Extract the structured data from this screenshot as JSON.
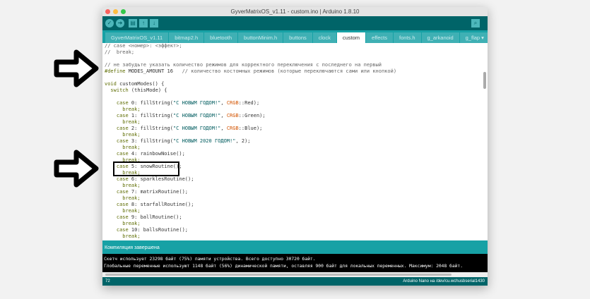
{
  "window": {
    "title": "GyverMatrixOS_v1.11 - custom.ino | Arduino 1.8.10"
  },
  "toolbar": {
    "verify": "✓",
    "upload": "➜",
    "new": "▤",
    "open": "↑",
    "save": "↓",
    "serial": "⌕"
  },
  "tabs": [
    {
      "label": "GyverMatrixOS_v1.11"
    },
    {
      "label": "bitmap2.h"
    },
    {
      "label": "bluetooth"
    },
    {
      "label": "buttonMinim.h"
    },
    {
      "label": "buttons"
    },
    {
      "label": "clock"
    },
    {
      "label": "custom",
      "active": true
    },
    {
      "label": "effects"
    },
    {
      "label": "fonts.h"
    },
    {
      "label": "g_arkanoid"
    },
    {
      "label": "g_flap ▾"
    }
  ],
  "code": {
    "l1": "// case <номер>: <эффект>;",
    "l2": "//  break;",
    "l4": "// не забудьте указать количество режимов для корректного переключения с последнего на первый",
    "l5a": "#define",
    "l5b": " MODES_AMOUNT 16   ",
    "l5c": "// количество костомных режимов (которые переключаются сами или кнопкой)",
    "l7a": "void",
    "l7b": " customModes() {",
    "l8a": "  switch",
    "l8b": " (thisMode) {",
    "cases": [
      {
        "n": " 0: fillString(",
        "s": "\"С НОВЫМ ГОДОМ!\"",
        "m": ", ",
        "t": "CRGB",
        "e": "::Red);"
      },
      {
        "n": " 1: fillString(",
        "s": "\"С НОВЫМ ГОДОМ!\"",
        "m": ", ",
        "t": "CRGB",
        "e": "::Green);"
      },
      {
        "n": " 2: fillString(",
        "s": "\"С НОВЫМ ГОДОМ!\"",
        "m": ", ",
        "t": "CRGB",
        "e": "::Blue);"
      },
      {
        "n": " 3: fillString(",
        "s": "\"С НОВЫМ 2020 ГОДОМ!\"",
        "m": ", 2);",
        "t": "",
        "e": ""
      },
      {
        "n": " 4: rainbowNoise();",
        "s": "",
        "m": "",
        "t": "",
        "e": ""
      },
      {
        "n": " 5: snowRoutine();",
        "s": "",
        "m": "",
        "t": "",
        "e": ""
      },
      {
        "n": " 6: sparklesRoutine();",
        "s": "",
        "m": "",
        "t": "",
        "e": ""
      },
      {
        "n": " 7: matrixRoutine();",
        "s": "",
        "m": "",
        "t": "",
        "e": ""
      },
      {
        "n": " 8: starfallRoutine();",
        "s": "",
        "m": "",
        "t": "",
        "e": ""
      },
      {
        "n": " 9: ballRoutine();",
        "s": "",
        "m": "",
        "t": "",
        "e": ""
      },
      {
        "n": " 10: ballsRoutine();",
        "s": "",
        "m": "",
        "t": "",
        "e": ""
      }
    ],
    "case_kw": "    case",
    "break_kw": "      break;"
  },
  "console": {
    "header": "Компиляция завершена",
    "line1": "Скетч использует 23298 байт (75%) памяти устройства. Всего доступно 30720 байт.",
    "line2": "Глобальные переменные используют 1148 байт (56%) динамической памяти, оставляя 900 байт для локальных переменных. Максимум: 2048 байт."
  },
  "status": {
    "line": "72",
    "board": "Arduino Nano на /dev/cu.wchusbserial1430"
  },
  "colors": {
    "teal_dark": "#006468",
    "teal": "#17a1a5"
  }
}
